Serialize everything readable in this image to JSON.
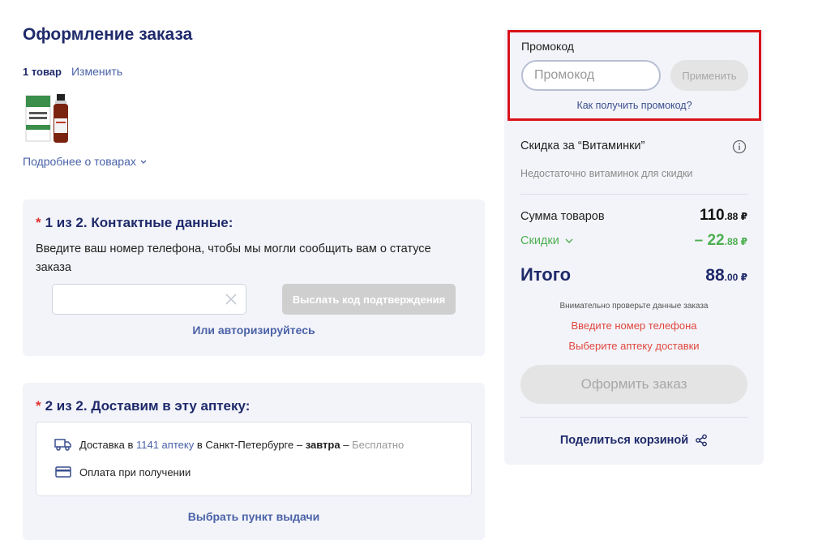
{
  "page": {
    "title": "Оформление заказа"
  },
  "items": {
    "count": "1 товар",
    "change": "Изменить",
    "more": "Подробнее о товарах"
  },
  "contact": {
    "title": "1 из 2. Контактные данные:",
    "description": "Введите ваш номер телефона, чтобы мы могли сообщить вам о статусе заказа",
    "phone_value": "",
    "send_code": "Выслать код подтверждения",
    "auth": "Или авторизируйтесь"
  },
  "delivery": {
    "title": "2 из 2. Доставим в эту аптеку:",
    "text_prefix": "Доставка в",
    "pharmacy": "1141 аптеку",
    "text_city": "в Санкт-Петербурге –",
    "when": "завтра",
    "dash": "–",
    "cost": "Бесплатно",
    "payment": "Оплата при получении",
    "pickup": "Выбрать пункт выдачи"
  },
  "promo": {
    "label": "Промокод",
    "placeholder": "Промокод",
    "apply": "Применить",
    "how": "Как получить промокод?"
  },
  "vitamins": {
    "title": "Скидка за “Витаминки”",
    "note": "Недостаточно витаминок для скидки"
  },
  "summary": {
    "sum_label": "Сумма товаров",
    "sum_main": "110",
    "sum_cents": ".88 ₽",
    "discount_label": "Скидки",
    "discount_main": "– 22",
    "discount_cents": ".88 ₽",
    "total_label": "Итого",
    "total_main": "88",
    "total_cents": ".00 ₽",
    "check_note": "Внимательно проверьте данные заказа",
    "error_phone": "Введите номер телефона",
    "error_pharmacy": "Выберите аптеку доставки",
    "order_button": "Оформить заказ",
    "share": "Поделиться корзиной"
  },
  "colors": {
    "accent": "#1f2a6b",
    "link": "#4a62a8",
    "error": "#e0473f",
    "discount": "#4caf50",
    "highlight": "#d9121a"
  }
}
